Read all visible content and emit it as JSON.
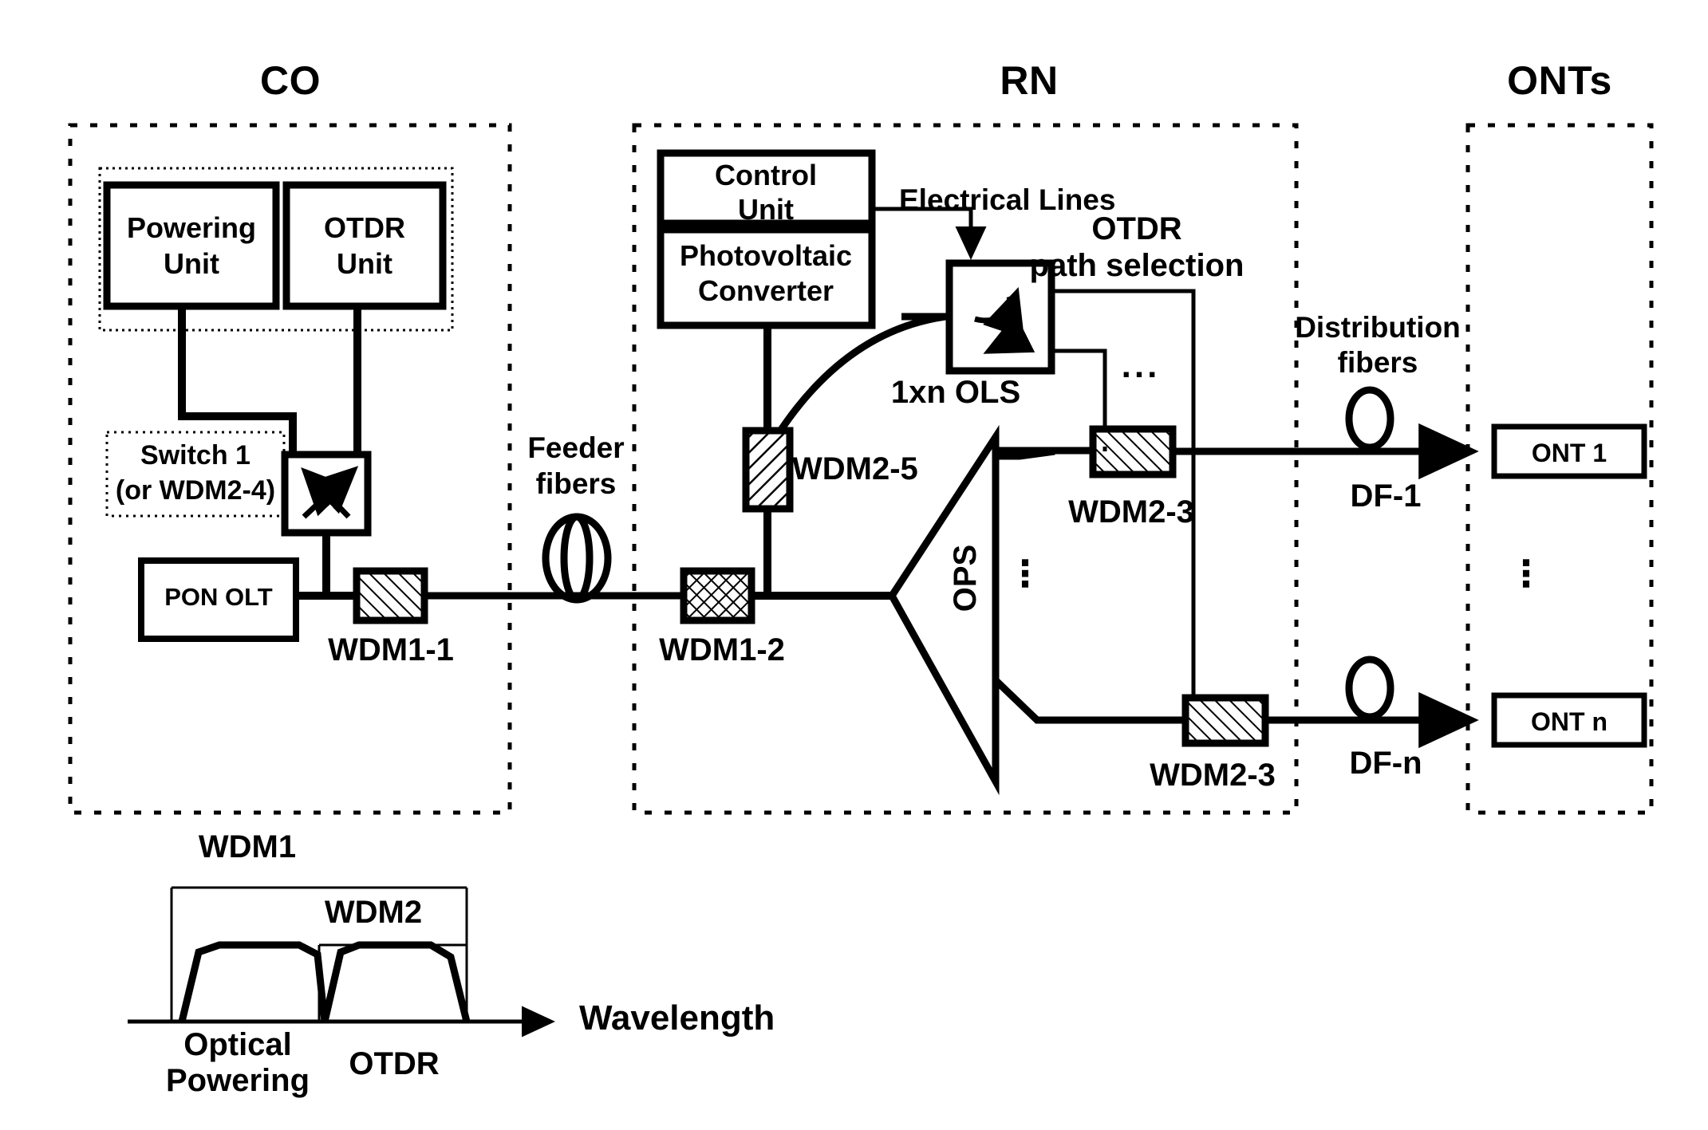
{
  "figure": {
    "title": "PON with optical powering and OTDR path selection",
    "sections": [
      {
        "id": "co",
        "label": "CO"
      },
      {
        "id": "rn",
        "label": "RN"
      },
      {
        "id": "onts",
        "label": "ONTs"
      }
    ]
  },
  "co": {
    "powering_unit": "Powering\nUnit",
    "powering_unit_line1": "Powering",
    "powering_unit_line2": "Unit",
    "otdr_unit_line1": "OTDR",
    "otdr_unit_line2": "Unit",
    "switch_label_line1": "Switch 1",
    "switch_label_line2": "(or WDM2-4)",
    "pon_olt": "PON OLT",
    "wdm1_1": "WDM1-1"
  },
  "feeder": {
    "label_line1": "Feeder",
    "label_line2": "fibers"
  },
  "rn": {
    "control_unit_line1": "Control",
    "control_unit_line2": "Unit",
    "photovoltaic_line1": "Photovoltaic",
    "photovoltaic_line2": "Converter",
    "electrical_lines": "Electrical Lines",
    "otdr_path_line1": "OTDR",
    "otdr_path_line2": "path selection",
    "ols_label": "1xn OLS",
    "wdm2_5": "WDM2-5",
    "wdm1_2": "WDM1-2",
    "ops_label": "OPS",
    "wdm2_3_top": "WDM2-3",
    "wdm2_3_bottom": "WDM2-3",
    "ellipsis_horizontal": "...",
    "ellipsis_vertical_ops": "⋮",
    "ellipsis_vertical_branch": "⋮"
  },
  "distribution": {
    "label_line1": "Distribution",
    "label_line2": "fibers",
    "df_1": "DF-1",
    "df_n": "DF-n"
  },
  "onts": {
    "ont_1": "ONT 1",
    "ont_n": "ONT n",
    "ellipsis_vertical": "⋮"
  },
  "spectrum": {
    "wdm1_label": "WDM1",
    "wdm2_label": "WDM2",
    "axis_label": "Wavelength",
    "band_left_line1": "Optical",
    "band_left_line2": "Powering",
    "band_right": "OTDR"
  },
  "chart_data": {
    "type": "line",
    "title": "WDM passband allocation vs wavelength",
    "xlabel": "Wavelength",
    "ylabel": "",
    "grid": false,
    "legend": false,
    "annotations": [
      "WDM1",
      "WDM2",
      "Optical Powering",
      "OTDR"
    ],
    "series": [
      {
        "name": "Optical Powering band",
        "x": [
          0.06,
          0.13,
          0.22,
          0.52,
          0.6,
          0.655
        ],
        "y": [
          0,
          0.72,
          0.84,
          0.84,
          0.72,
          0
        ]
      },
      {
        "name": "OTDR band",
        "x": [
          0.655,
          0.715,
          0.79,
          1.02,
          1.1,
          1.17
        ],
        "y": [
          0,
          0.72,
          0.84,
          0.84,
          0.72,
          0
        ]
      }
    ],
    "bands": [
      {
        "label": "WDM1",
        "x0": 0.06,
        "x1": 1.17,
        "top": 1.0
      },
      {
        "label": "WDM2",
        "x0": 0.655,
        "x1": 1.17,
        "top": 0.72
      }
    ],
    "xlim": [
      0,
      1.6
    ],
    "ylim": [
      0,
      1.12
    ]
  },
  "colors": {
    "stroke": "#000000",
    "background": "#ffffff",
    "hatch": "#000000"
  }
}
